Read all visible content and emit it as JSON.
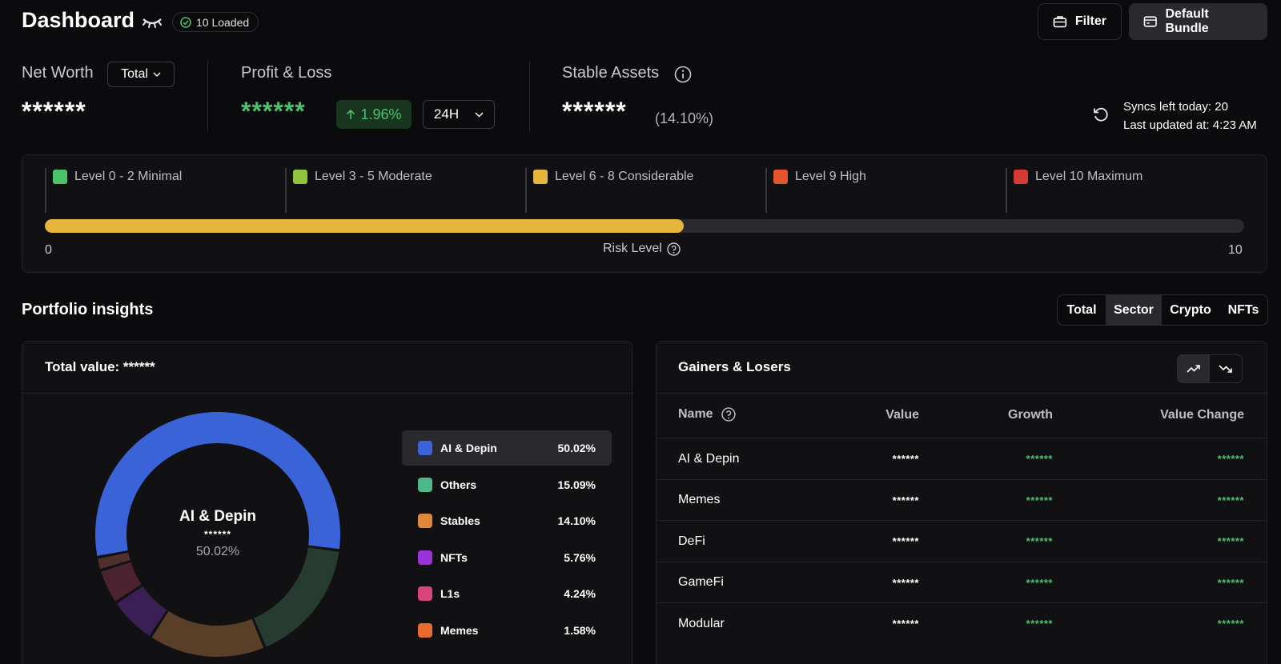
{
  "header": {
    "title": "Dashboard",
    "loaded_badge": "10 Loaded",
    "filter_label": "Filter",
    "bundle_label": "Default Bundle"
  },
  "stats": {
    "net_worth": {
      "label": "Net Worth",
      "select": "Total",
      "value": "******"
    },
    "pnl": {
      "label": "Profit & Loss",
      "value": "******",
      "change": "1.96%",
      "period": "24H"
    },
    "stable": {
      "label": "Stable Assets",
      "value": "******",
      "pct": "(14.10%)"
    },
    "sync": {
      "syncs_left": "Syncs left today: 20",
      "last_updated": "Last updated at: 4:23 AM"
    }
  },
  "risk": {
    "levels": [
      {
        "label": "Level 0 - 2 Minimal",
        "color": "#4cc26a"
      },
      {
        "label": "Level 3 - 5 Moderate",
        "color": "#8fc43c"
      },
      {
        "label": "Level 6 - 8 Considerable",
        "color": "#e6b63c"
      },
      {
        "label": "Level 9 High",
        "color": "#e2552e"
      },
      {
        "label": "Level 10 Maximum",
        "color": "#d63a34"
      }
    ],
    "min": "0",
    "max": "10",
    "caption": "Risk Level",
    "value": 5.33,
    "bar_color": "#e6b63c"
  },
  "insights": {
    "title": "Portfolio insights",
    "tabs": [
      "Total",
      "Sector",
      "Crypto",
      "NFTs"
    ],
    "active_tab": "Sector"
  },
  "allocation": {
    "total_label": "Total value: ******",
    "center": {
      "name": "AI & Depin",
      "value": "******",
      "pct": "50.02%"
    }
  },
  "chart_data": {
    "type": "pie",
    "title": "",
    "categories": [
      "AI & Depin",
      "Others",
      "Stables",
      "NFTs",
      "L1s",
      "Memes"
    ],
    "values": [
      50.02,
      15.09,
      14.1,
      5.76,
      4.24,
      1.58
    ],
    "labels": [
      "50.02%",
      "15.09%",
      "14.10%",
      "5.76%",
      "4.24%",
      "1.58%"
    ],
    "legend_colors": [
      "#3a63d8",
      "#4fb88a",
      "#e0883a",
      "#9a32d8",
      "#d8457a",
      "#e86a2e"
    ],
    "ring_colors": [
      "#3a63d8",
      "#263c31",
      "#5a3f28",
      "#3a1f55",
      "#4a2230",
      "#50302a"
    ],
    "legend_position": "right",
    "active_index": 0
  },
  "gainers": {
    "title": "Gainers & Losers",
    "columns": [
      "Name",
      "Value",
      "Growth",
      "Value Change"
    ],
    "rows": [
      {
        "name": "AI & Depin",
        "value": "******",
        "growth": "******",
        "change": "******"
      },
      {
        "name": "Memes",
        "value": "******",
        "growth": "******",
        "change": "******"
      },
      {
        "name": "DeFi",
        "value": "******",
        "growth": "******",
        "change": "******"
      },
      {
        "name": "GameFi",
        "value": "******",
        "growth": "******",
        "change": "******"
      },
      {
        "name": "Modular",
        "value": "******",
        "growth": "******",
        "change": "******"
      }
    ]
  }
}
